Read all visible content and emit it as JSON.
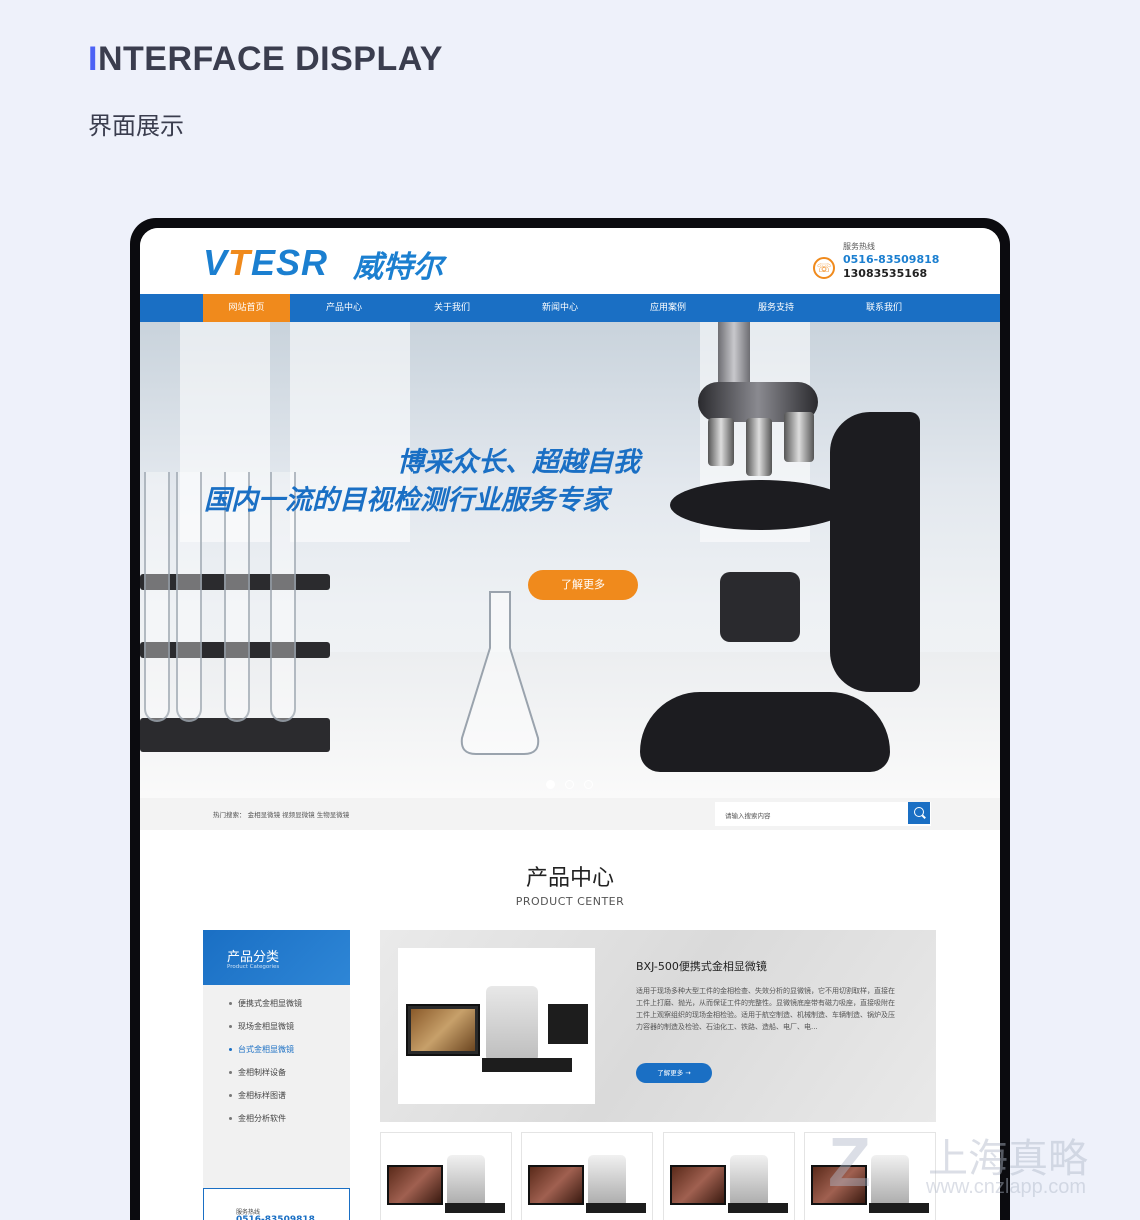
{
  "header": {
    "en_first": "I",
    "en_rest": "NTERFACE DISPLAY",
    "zh": "界面展示"
  },
  "site": {
    "logo_v": "V",
    "logo_t": "T",
    "logo_esr": "ESR",
    "logo_cn": "威特尔",
    "hotline_label": "服务热线",
    "phone1": "0516-83509818",
    "phone2": "13083535168",
    "nav": [
      "网站首页",
      "产品中心",
      "关于我们",
      "新闻中心",
      "应用案例",
      "服务支持",
      "联系我们"
    ],
    "hero": {
      "line1": "博采众长、超越自我",
      "line2": "国内一流的目视检测行业服务专家",
      "button": "了解更多"
    },
    "search": {
      "hot": "热门搜索：  金相显微镜  视频显微镜  生物显微镜",
      "placeholder": "请输入搜索内容"
    },
    "products": {
      "title": "产品中心",
      "subtitle": "PRODUCT CENTER",
      "sidebar_title": "产品分类",
      "sidebar_sub": "Product Categories",
      "categories": [
        "便携式金相显微镜",
        "现场金相显微镜",
        "台式金相显微镜",
        "金相制样设备",
        "金相标样图谱",
        "金相分析软件"
      ],
      "active_index": 2,
      "contact_label": "服务热线",
      "contact_num": "0516-83509818",
      "featured": {
        "title": "BXJ-500便携式金相显微镜",
        "desc": "适用于现场多种大型工件的金相检查、失效分析的显微镜，它不用切割取样，直接在工件上打磨、抛光，从而保证工件的完整性。显微镜底座带有磁力吸座，直接吸附在工件上观察组织的现场金相检验。适用于航空制造、机械制造、车辆制造、锅炉及压力容器的制造及检验、石油化工、铁路、造船、电厂、电...",
        "button": "了解更多 →"
      }
    }
  },
  "watermark": {
    "text": "上海真略",
    "url": "www.cnzlapp.com"
  },
  "colors": {
    "brand_blue": "#1a6fc4",
    "brand_orange": "#f08a1c",
    "accent_title": "#4d63f5"
  }
}
